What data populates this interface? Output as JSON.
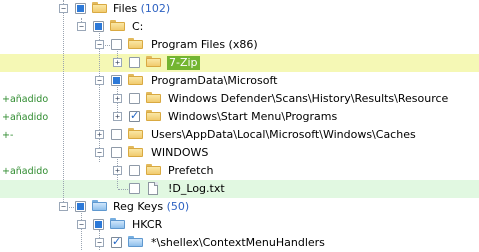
{
  "gutter": {
    "r4": "+añadido",
    "r6": "+añadido",
    "r7": "+-",
    "r10": "+añadido"
  },
  "tree": {
    "files_label": "Files",
    "files_count": "(102)",
    "c_label": "C:",
    "program_files": "Program Files (x86)",
    "zip": "7-Zip",
    "programdata": "ProgramData\\Microsoft",
    "defender": "Windows Defender\\Scans\\History\\Results\\Resource",
    "startmenu": "Windows\\Start Menu\\Programs",
    "users_caches": "Users\\AppData\\Local\\Microsoft\\Windows\\Caches",
    "windows": "WINDOWS",
    "prefetch": "Prefetch",
    "dlog": "!D_Log.txt",
    "regkeys_label": "Reg Keys",
    "regkeys_count": "(50)",
    "hkcr": "HKCR",
    "shellex": "*\\shellex\\ContextMenuHandlers"
  },
  "colors": {
    "highlight_selected": "#f5f8b5",
    "highlight_added": "#e1f8e1",
    "added_text": "#2e8b2e",
    "count_text": "#2f63c2",
    "badge": "#73b531"
  },
  "icons": [
    "folder-icon",
    "folder-blue-icon",
    "file-icon",
    "expand-icon",
    "collapse-icon",
    "checkbox-icon"
  ]
}
